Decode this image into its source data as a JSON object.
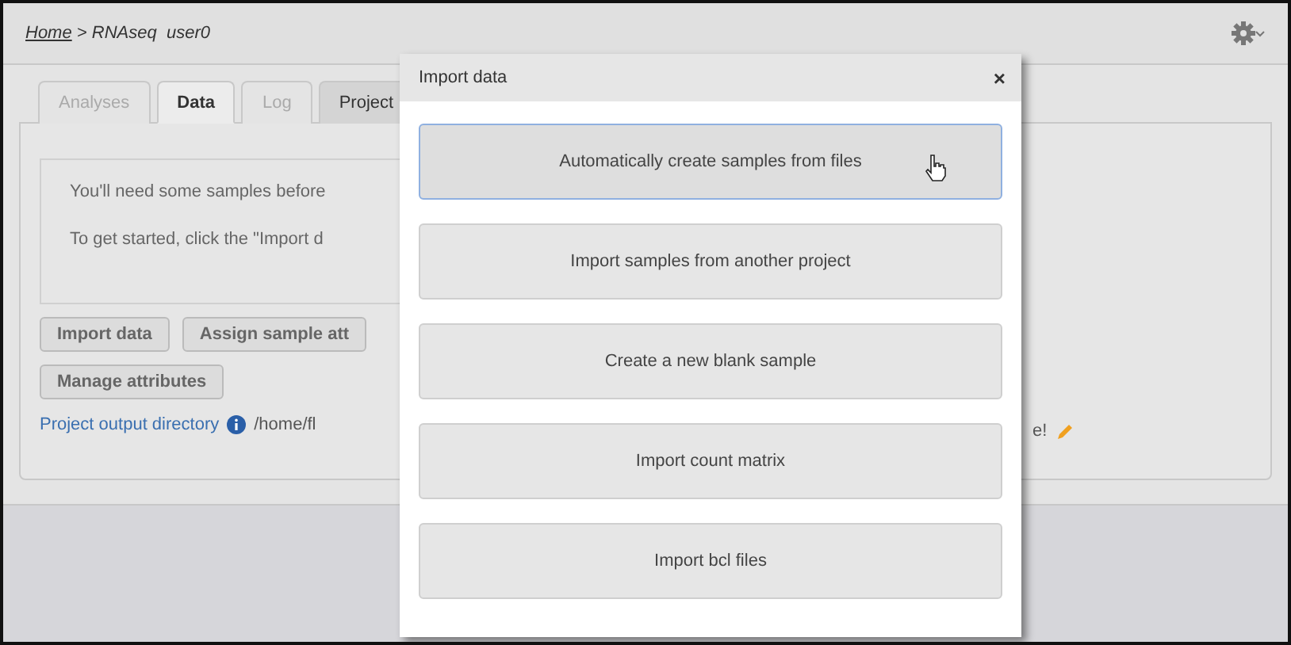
{
  "breadcrumb": {
    "home": "Home",
    "separator": ">",
    "path": "RNAseq  user0"
  },
  "tabs": [
    {
      "label": "Analyses",
      "selected": false,
      "disabled": true
    },
    {
      "label": "Data",
      "selected": true,
      "disabled": false
    },
    {
      "label": "Log",
      "selected": false,
      "disabled": true
    },
    {
      "label": "Project",
      "selected": false,
      "disabled": false
    }
  ],
  "message": [
    "You'll need some samples before",
    "To get started, click the \"Import d"
  ],
  "actions": [
    [
      "Import data",
      "Assign sample att"
    ],
    [
      "Manage attributes"
    ]
  ],
  "output_directory": {
    "label": "Project output directory",
    "path": "/home/fl",
    "trailing": "e!"
  },
  "dialog": {
    "title": "Import data",
    "close": "×",
    "options": [
      {
        "label": "Automatically create samples from files",
        "selected": true
      },
      {
        "label": "Import samples from another project",
        "selected": false
      },
      {
        "label": "Create a new blank sample",
        "selected": false
      },
      {
        "label": "Import count matrix",
        "selected": false
      },
      {
        "label": "Import bcl files",
        "selected": false
      }
    ]
  }
}
